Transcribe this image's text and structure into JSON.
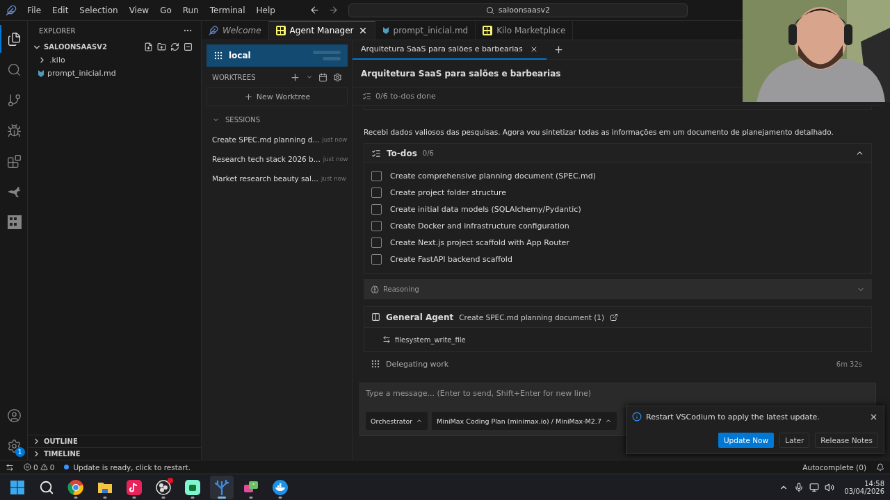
{
  "menu": [
    "File",
    "Edit",
    "Selection",
    "View",
    "Go",
    "Run",
    "Terminal",
    "Help"
  ],
  "search": {
    "value": "saloonsaasv2"
  },
  "activity_bar": [
    {
      "kind": "files",
      "selected": true
    },
    {
      "kind": "search",
      "selected": false
    },
    {
      "kind": "git",
      "selected": false
    },
    {
      "kind": "debug",
      "selected": false
    },
    {
      "kind": "extensions",
      "selected": false
    },
    {
      "kind": "kangaroo",
      "selected": false
    },
    {
      "kind": "kilo",
      "selected": false
    }
  ],
  "activity_bottom": {
    "settings_badge": "1"
  },
  "explorer": {
    "title": "EXPLORER",
    "folder": "SALOONSAASV2",
    "expanded": true,
    "items": [
      {
        "label": ".kilo",
        "kind": "folder",
        "expanded": false
      },
      {
        "label": "prompt_inicial.md",
        "kind": "markdown"
      }
    ],
    "sections": [
      {
        "label": "OUTLINE",
        "expanded": false
      },
      {
        "label": "TIMELINE",
        "expanded": false
      }
    ]
  },
  "editor_tabs": [
    {
      "label": "Welcome",
      "kind": "welcome",
      "selected": false
    },
    {
      "label": "Agent Manager",
      "kind": "kilo",
      "selected": true
    },
    {
      "label": "prompt_inicial.md",
      "kind": "markdown",
      "selected": false
    },
    {
      "label": "Kilo Marketplace",
      "kind": "kilo",
      "selected": false
    }
  ],
  "agent_manager": {
    "workspace": {
      "label": "local",
      "selected": true
    },
    "worktrees_title": "WORKTREES",
    "new_worktree": "New Worktree",
    "sessions_title": "SESSIONS",
    "sessions_expanded": true,
    "sessions": [
      {
        "title": "Create SPEC.md planning d...",
        "time": "just now"
      },
      {
        "title": "Research tech stack 2026 b...",
        "time": "just now"
      },
      {
        "title": "Market research beauty sal...",
        "time": "just now"
      }
    ]
  },
  "session": {
    "tabs": [
      {
        "label": "Arquitetura SaaS para salões e barbearias",
        "selected": true
      }
    ],
    "title": "Arquitetura SaaS para salões e barbearias",
    "todo_summary": "0/6 to-dos done",
    "message": "Recebi dados valiosos das pesquisas. Agora vou sintetizar todas as informações em um documento de planejamento detalhado.",
    "todos": {
      "title": "To-dos",
      "count": "0/6",
      "expanded": true,
      "items": [
        {
          "label": "Create comprehensive planning document (SPEC.md)",
          "checked": false
        },
        {
          "label": "Create project folder structure",
          "checked": false
        },
        {
          "label": "Create initial data models (SQLAlchemy/Pydantic)",
          "checked": false
        },
        {
          "label": "Create Docker and infrastructure configuration",
          "checked": false
        },
        {
          "label": "Create Next.js project scaffold with App Router",
          "checked": false
        },
        {
          "label": "Create FastAPI backend scaffold",
          "checked": false
        }
      ]
    },
    "reasoning": {
      "label": "Reasoning",
      "expanded": false
    },
    "agent": {
      "name": "General Agent",
      "task": "Create SPEC.md planning document (1)",
      "tool": "filesystem_write_file"
    },
    "status": {
      "label": "Delegating work",
      "elapsed": "6m 32s"
    },
    "composer": {
      "placeholder": "Type a message... (Enter to send, Shift+Enter for new line)",
      "mode": "Orchestrator",
      "model": "MiniMax Coding Plan (minimax.io) / MiniMax-M2.7"
    }
  },
  "notification": {
    "message": "Restart VSCodium to apply the latest update.",
    "buttons": [
      {
        "label": "Update Now",
        "kind": "primary"
      },
      {
        "label": "Later",
        "kind": "secondary"
      },
      {
        "label": "Release Notes",
        "kind": "secondary"
      }
    ]
  },
  "status_bar": {
    "errors": "0",
    "warnings": "0",
    "update": "Update is ready, click to restart.",
    "autocomplete": "Autocomplete (0)"
  },
  "taskbar": {
    "apps": [
      {
        "kind": "windows",
        "selected": false
      },
      {
        "kind": "search",
        "selected": false
      },
      {
        "kind": "chrome",
        "running": true,
        "selected": false
      },
      {
        "kind": "folder",
        "running": true,
        "selected": false
      },
      {
        "kind": "tiktok",
        "running": true,
        "selected": false
      },
      {
        "kind": "obs",
        "running": true,
        "selected": false,
        "alert": true
      },
      {
        "kind": "stream",
        "running": true,
        "selected": false
      },
      {
        "kind": "codium",
        "running": true,
        "selected": true
      },
      {
        "kind": "chat",
        "running": true,
        "selected": false
      },
      {
        "kind": "docker",
        "running": true,
        "selected": false
      }
    ],
    "time": "14:58",
    "date": "03/04/2026"
  }
}
